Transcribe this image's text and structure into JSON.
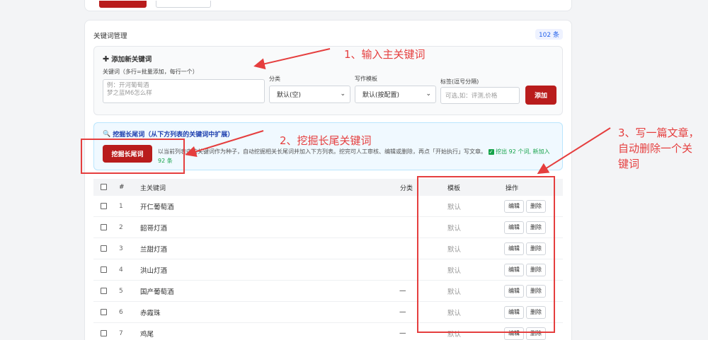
{
  "section": {
    "title": "关键词管理",
    "count": "102 条"
  },
  "add_panel": {
    "title": "添加新关键词",
    "keywords_label": "关键词（多行=批量添加，每行一个）",
    "keywords_placeholder": "例：开河葡萄酒\n梦之蓝M6怎么样",
    "category_label": "分类",
    "category_value": "默认(空)",
    "template_label": "写作模板",
    "template_value": "默认(按配置)",
    "tags_label": "标签(逗号分隔)",
    "tags_placeholder": "可选,如：评测,价格",
    "add_button": "添加"
  },
  "mine_panel": {
    "title": "挖掘长尾词（从下方列表的关键词中扩展）",
    "button": "挖掘长尾词",
    "desc_main": "以当前列表中的关键词作为种子，自动挖掘相关长尾词并加入下方列表。挖完可人工审核、编辑或删除，再点「开始执行」写文章。",
    "desc_result": "挖出 92 个词, 新加入 92 条"
  },
  "table": {
    "headers": {
      "idx": "#",
      "keyword": "主关键词",
      "category": "分类",
      "template": "模板",
      "ops": "操作"
    },
    "edit_label": "编辑",
    "delete_label": "删除",
    "rows": [
      {
        "idx": "1",
        "keyword": "开仁葡萄酒",
        "category": "",
        "template": "默认"
      },
      {
        "idx": "2",
        "keyword": "韶哥灯酒",
        "category": "",
        "template": "默认"
      },
      {
        "idx": "3",
        "keyword": "兰甜灯酒",
        "category": "",
        "template": "默认"
      },
      {
        "idx": "4",
        "keyword": "洪山灯酒",
        "category": "",
        "template": "默认"
      },
      {
        "idx": "5",
        "keyword": "国产葡萄酒",
        "category": "—",
        "template": "默认"
      },
      {
        "idx": "6",
        "keyword": "赤霞珠",
        "category": "—",
        "template": "默认"
      },
      {
        "idx": "7",
        "keyword": "鸡尾",
        "category": "—",
        "template": "默认"
      }
    ]
  },
  "annotations": {
    "step1": "1、输入主关键词",
    "step2": "2、挖掘长尾关键词",
    "step3": "3、写一篇文章，自动删除一个关键词"
  },
  "colors": {
    "primary_red": "#b91c1c",
    "annotation_red": "#e53e3e",
    "info_bg": "#f0f9ff"
  }
}
